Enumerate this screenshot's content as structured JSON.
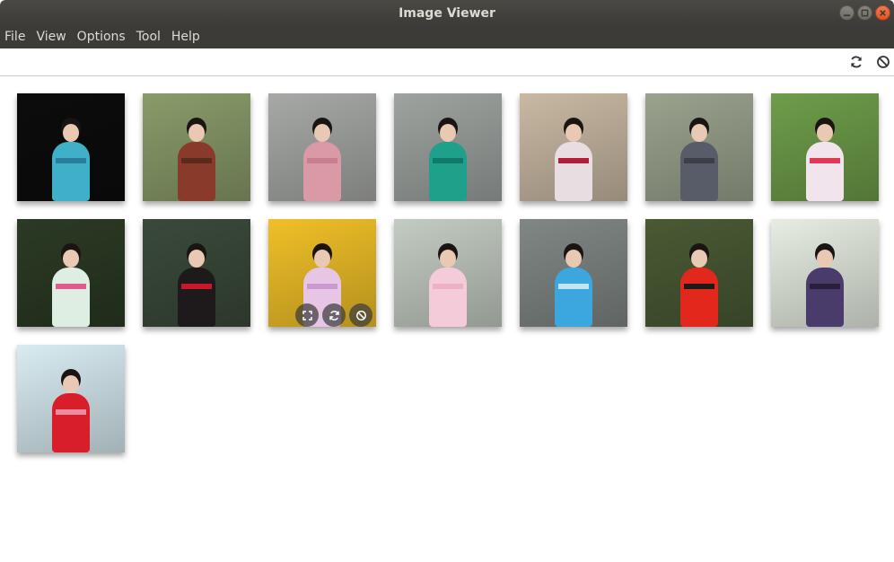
{
  "window": {
    "title": "Image Viewer"
  },
  "menu": [
    "File",
    "View",
    "Options",
    "Tool",
    "Help"
  ],
  "thumbnails": [
    {
      "bg": "#0c0c0c",
      "robe": "#3fb0c8",
      "sash": "#2a7d9c"
    },
    {
      "bg": "#8a9b6a",
      "robe": "#8a3a2a",
      "sash": "#5a2a1a"
    },
    {
      "bg": "#a7a9a6",
      "robe": "#d99aa6",
      "sash": "#c77f8f"
    },
    {
      "bg": "#9ea3a0",
      "robe": "#1fa08a",
      "sash": "#0f7a6a"
    },
    {
      "bg": "#c9b9a3",
      "robe": "#e8dde0",
      "sash": "#b21e3a"
    },
    {
      "bg": "#9aa38e",
      "robe": "#585c68",
      "sash": "#3c3f48"
    },
    {
      "bg": "#6e9d4a",
      "robe": "#f2e4ec",
      "sash": "#e23858"
    },
    {
      "bg": "#2b3a24",
      "robe": "#dfeee2",
      "sash": "#e05a8c"
    },
    {
      "bg": "#3a4a3a",
      "robe": "#1e1a1c",
      "sash": "#c8182a"
    },
    {
      "bg": "#f0c028",
      "robe": "#e6c6e4",
      "sash": "#c99ad0"
    },
    {
      "bg": "#c3ccc2",
      "robe": "#f4cbd8",
      "sash": "#efb0c4"
    },
    {
      "bg": "#808784",
      "robe": "#3ba7de",
      "sash": "#bfe7f2"
    },
    {
      "bg": "#4a5a34",
      "robe": "#e2281c",
      "sash": "#1e1a1a"
    },
    {
      "bg": "#e7ede2",
      "robe": "#4a3c6a",
      "sash": "#2a1e3a"
    },
    {
      "bg": "#d8ecf2",
      "robe": "#d81e2a",
      "sash": "#f08aa0"
    }
  ],
  "colors": {
    "titlebar": "#3c3b37",
    "menubar": "#3c3b37",
    "menu_text": "#dfdbd2",
    "close_button": "#e95420"
  }
}
